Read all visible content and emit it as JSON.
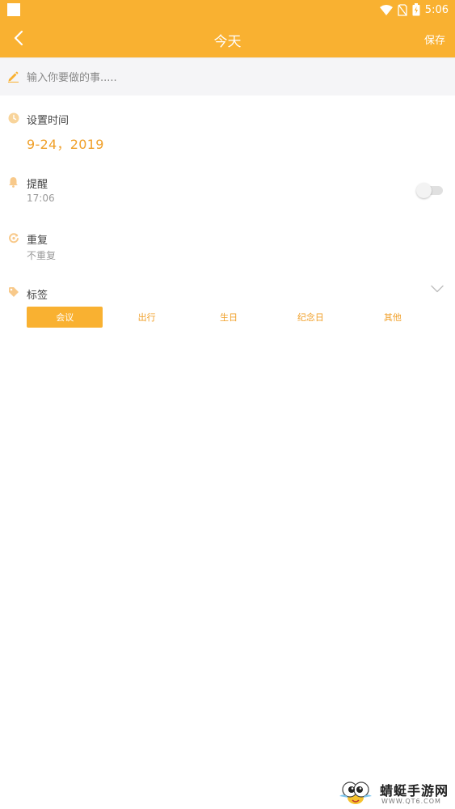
{
  "status_bar": {
    "time": "5:06"
  },
  "app_bar": {
    "title": "今天",
    "save_label": "保存"
  },
  "task_input": {
    "placeholder": "输入你要做的事....."
  },
  "set_time": {
    "title": "设置时间",
    "date": "9-24，2019"
  },
  "reminder": {
    "title": "提醒",
    "time": "17:06",
    "enabled": false
  },
  "repeat": {
    "title": "重复",
    "value": "不重复"
  },
  "tags": {
    "title": "标签",
    "items": [
      "会议",
      "出行",
      "生日",
      "纪念日",
      "其他"
    ],
    "selected": "会议"
  },
  "watermark": {
    "name": "蜻蜓手游网",
    "url": "WWW.QT6.COM"
  },
  "colors": {
    "accent": "#f9b131",
    "accent_text": "#f0a02a"
  }
}
